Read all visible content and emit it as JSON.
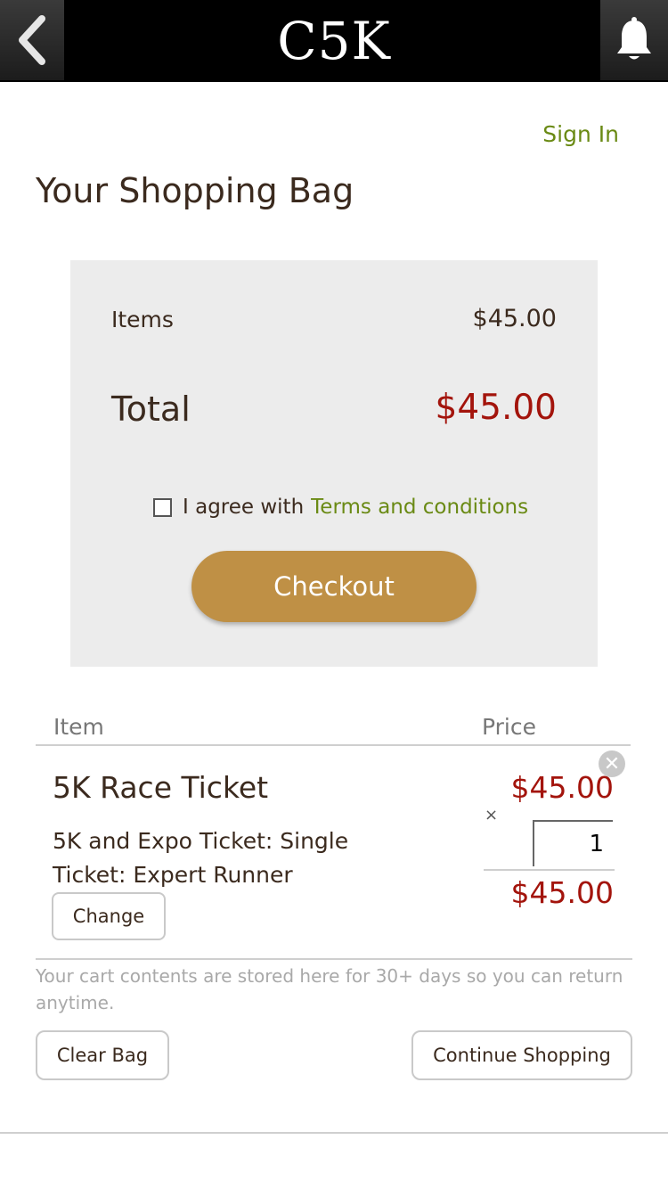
{
  "header": {
    "brand": "C5K",
    "back_icon": "chevron-left-icon",
    "bell_icon": "bell-icon"
  },
  "signin_label": "Sign In",
  "page_title": "Your Shopping Bag",
  "summary": {
    "items_label": "Items",
    "items_value": "$45.00",
    "total_label": "Total",
    "total_value": "$45.00",
    "agree_prefix": "I agree with",
    "terms_link": "Terms and conditions",
    "agree_checked": false,
    "checkout_label": "Checkout"
  },
  "cart": {
    "columns": [
      "Item",
      "Price"
    ],
    "items": [
      {
        "name": "5K Race Ticket",
        "description": "5K and Expo Ticket: Single Ticket: Expert Runner",
        "change_label": "Change",
        "unit_price": "$45.00",
        "multiply_symbol": "×",
        "quantity": "1",
        "line_total": "$45.00"
      }
    ]
  },
  "note": "Your cart contents are stored here for 30+ days so you can return anytime.",
  "actions": {
    "clear_label": "Clear Bag",
    "continue_label": "Continue Shopping"
  },
  "colors": {
    "accent_green": "#6a8a14",
    "price_red": "#a3140c",
    "checkout_gold": "#bf9045"
  }
}
